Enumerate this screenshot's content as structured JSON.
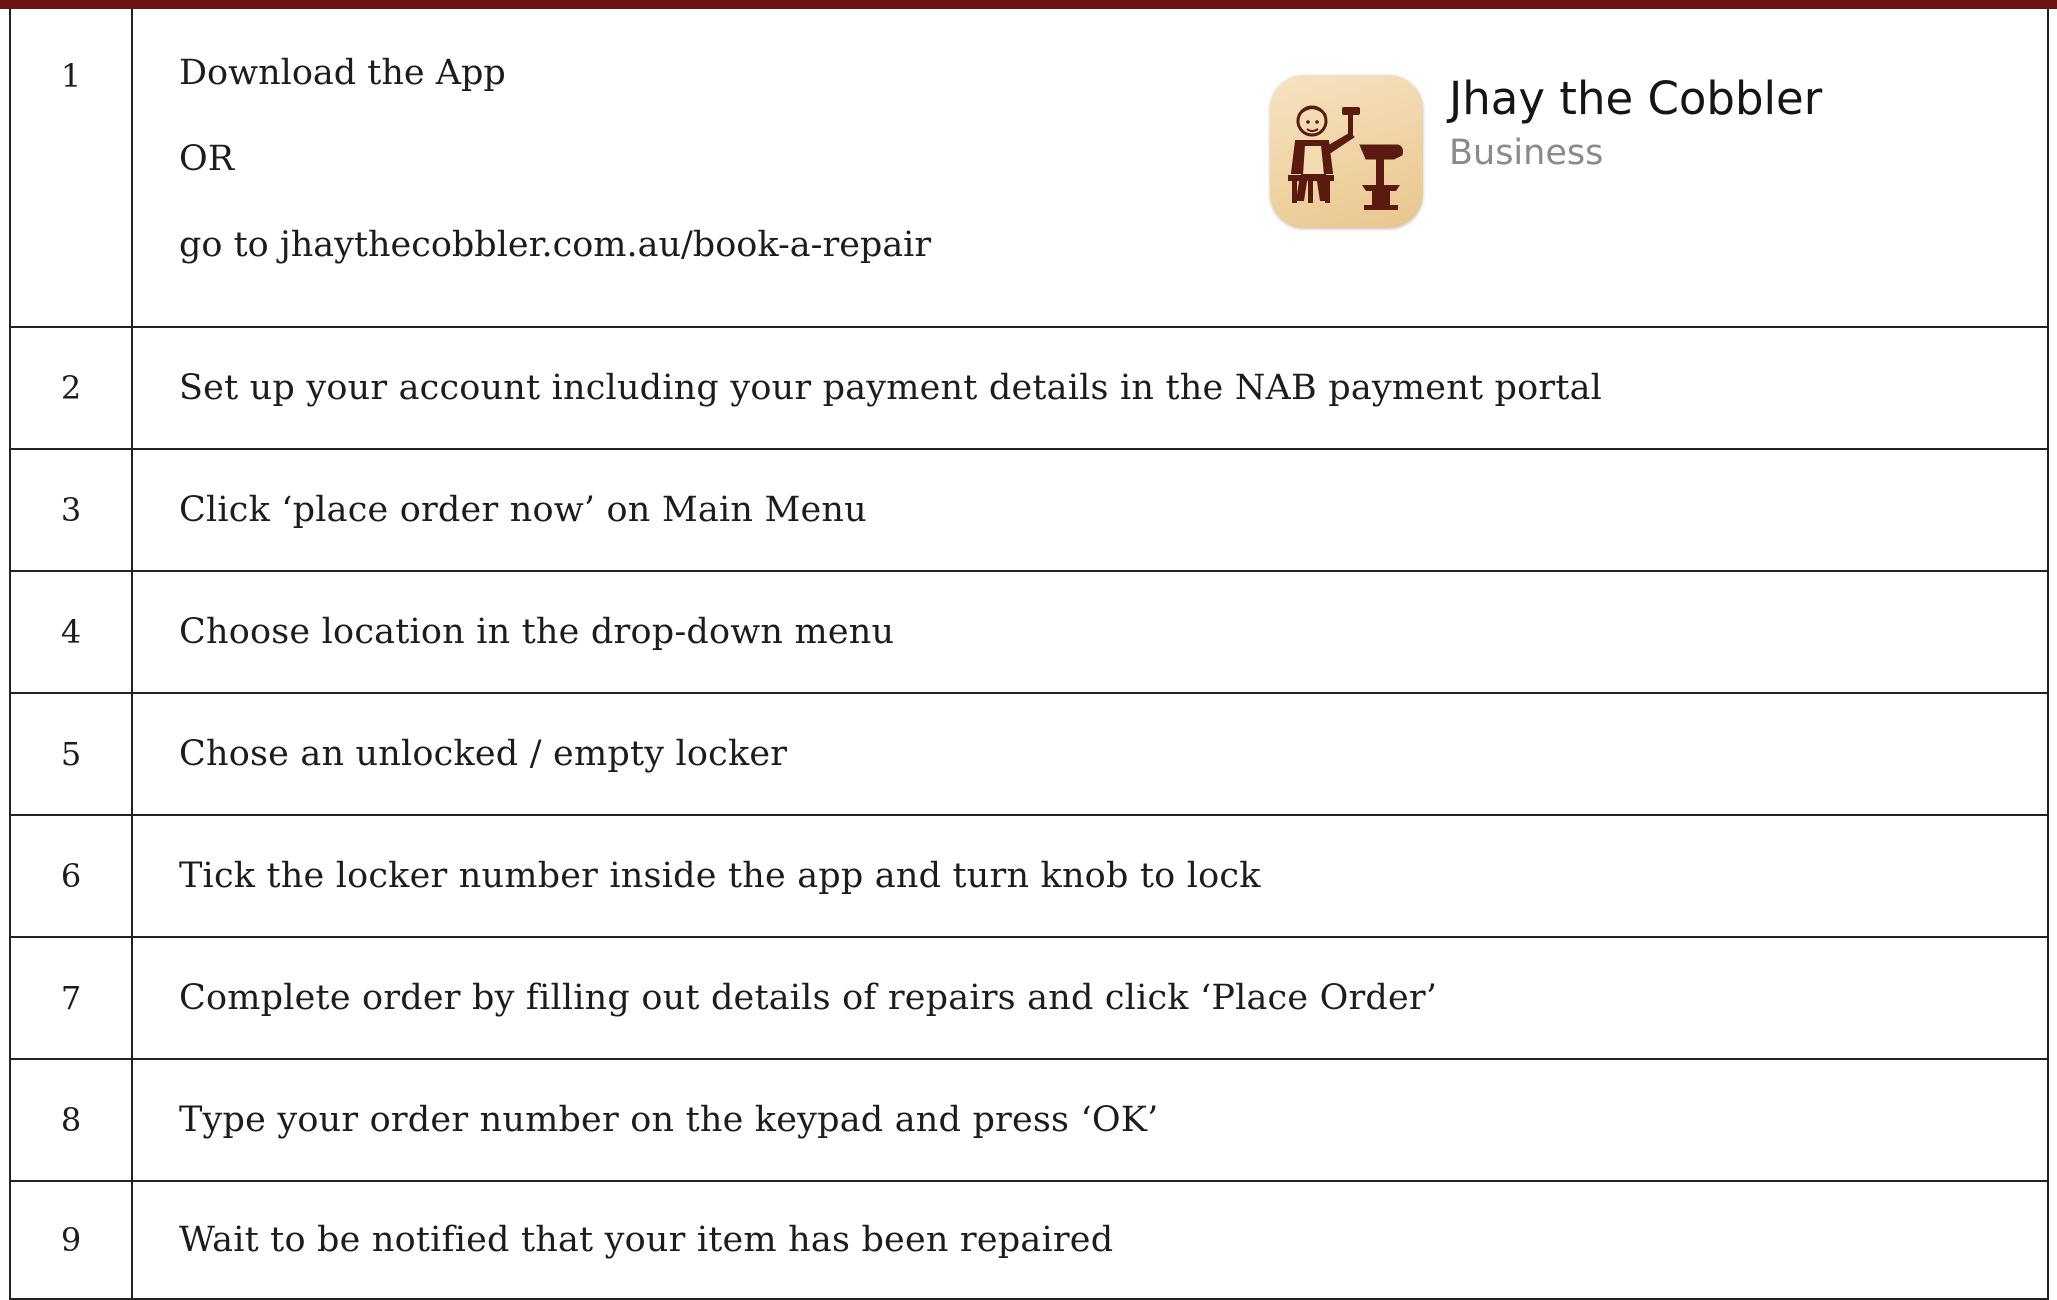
{
  "steps": [
    {
      "number": "1",
      "lines": [
        "Download the App",
        "OR",
        "go to jhaythecobbler.com.au/book-a-repair"
      ]
    },
    {
      "number": "2",
      "text": "Set up your account including your payment details in the NAB payment portal"
    },
    {
      "number": "3",
      "text": "Click ‘place order now’ on Main Menu"
    },
    {
      "number": "4",
      "text": "Choose location in the drop-down menu"
    },
    {
      "number": "5",
      "text": "Chose an unlocked / empty locker"
    },
    {
      "number": "6",
      "text": "Tick the locker number inside the app and turn knob to lock"
    },
    {
      "number": "7",
      "text": "Complete order by filling out details of repairs and click ‘Place Order’"
    },
    {
      "number": "8",
      "text": "Type your order number on the keypad and press ‘OK’"
    },
    {
      "number": "9",
      "text": "Wait to be notified that your item has been repaired"
    }
  ],
  "app": {
    "name": "Jhay the Cobbler",
    "category": "Business",
    "icon": "cobbler-at-workbench-icon"
  },
  "colors": {
    "top_bar": "#6b1411",
    "border": "#222222",
    "icon_background": "#f0d6a8",
    "icon_figure": "#5a1a10",
    "category_text": "#8a8a8e"
  }
}
